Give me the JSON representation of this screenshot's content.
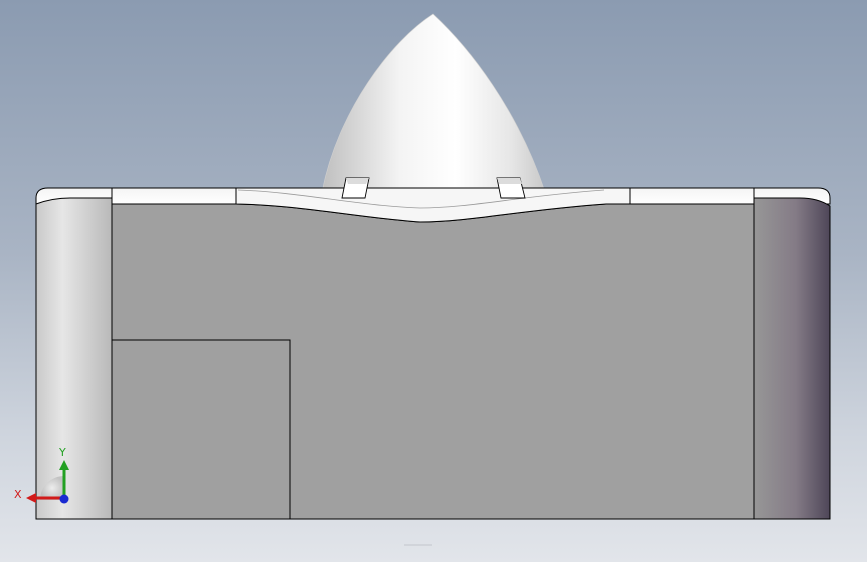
{
  "viewport": {
    "background_top": "#8b9bb1",
    "background_bottom": "#e2e5ea"
  },
  "part": {
    "face_color": "#a0a0a0",
    "edge_color": "#000000",
    "dome_color": "#ffffff"
  },
  "triad": {
    "x_label": "X",
    "y_label": "Y",
    "x_color": "#d11a1a",
    "y_color": "#22a022",
    "z_color": "#1a2ad1",
    "icon": "coordinate-triad-icon"
  }
}
